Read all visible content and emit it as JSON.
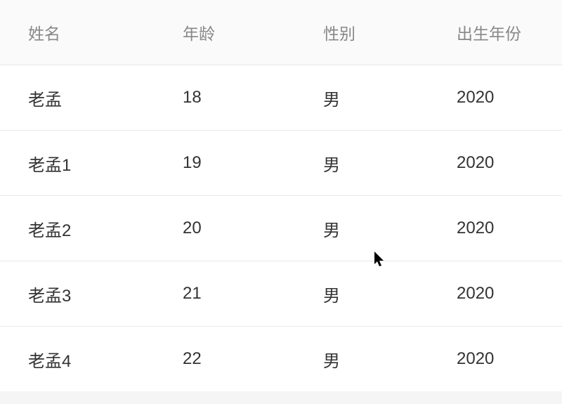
{
  "table": {
    "headers": {
      "name": "姓名",
      "age": "年龄",
      "gender": "性别",
      "birth_year": "出生年份"
    },
    "rows": [
      {
        "name": "老孟",
        "age": "18",
        "gender": "男",
        "birth_year": "2020"
      },
      {
        "name": "老孟1",
        "age": "19",
        "gender": "男",
        "birth_year": "2020"
      },
      {
        "name": "老孟2",
        "age": "20",
        "gender": "男",
        "birth_year": "2020"
      },
      {
        "name": "老孟3",
        "age": "21",
        "gender": "男",
        "birth_year": "2020"
      },
      {
        "name": "老孟4",
        "age": "22",
        "gender": "男",
        "birth_year": "2020"
      }
    ]
  }
}
